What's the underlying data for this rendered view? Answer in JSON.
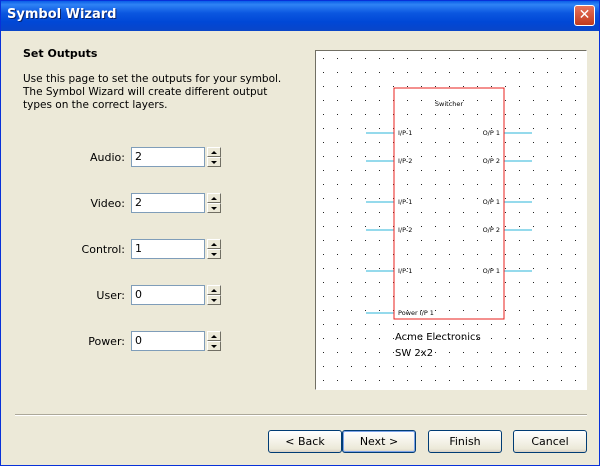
{
  "window": {
    "title": "Symbol Wizard",
    "close_glyph": "✕"
  },
  "page": {
    "heading": "Set Outputs",
    "description": "Use this page to set the outputs for your symbol. The Symbol Wizard will create different output types on the correct layers."
  },
  "fields": [
    {
      "label": "Audio:",
      "value": "2"
    },
    {
      "label": "Video:",
      "value": "2"
    },
    {
      "label": "Control:",
      "value": "1"
    },
    {
      "label": "User:",
      "value": "0"
    },
    {
      "label": "Power:",
      "value": "0"
    }
  ],
  "preview": {
    "symbol_name": "Switcher",
    "ports": {
      "audio_in": [
        "I/P-1",
        "I/P-2"
      ],
      "audio_out": [
        "O/P 1",
        "O/P 2"
      ],
      "video_in": [
        "I/P-1",
        "I/P-2"
      ],
      "video_out": [
        "O/P 1",
        "O/P 2"
      ],
      "control_in": [
        "I/P-1"
      ],
      "control_out": [
        "O/P 1"
      ],
      "power_in": [
        "Power I/P 1"
      ]
    },
    "manufacturer": "Acme Electronics",
    "model": "SW 2x2",
    "colors": {
      "box": "#e8201c",
      "wire": "#2bb5d8",
      "grid_dot": "#222222"
    }
  },
  "buttons": {
    "back": "< Back",
    "next": "Next >",
    "finish": "Finish",
    "cancel": "Cancel"
  }
}
